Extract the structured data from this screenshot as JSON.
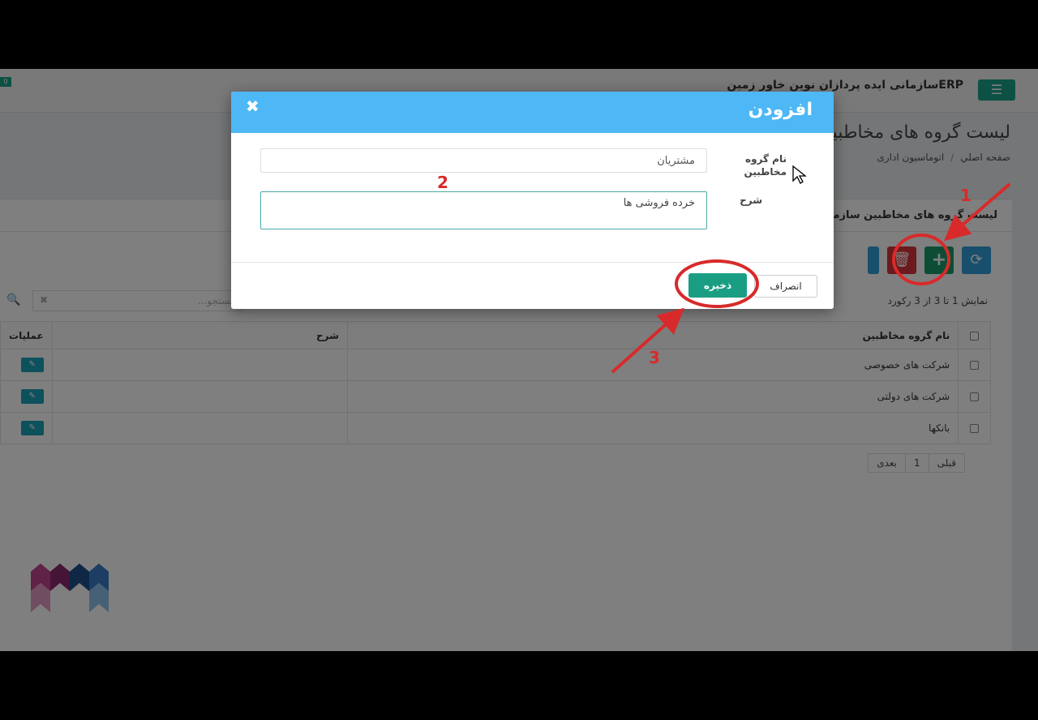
{
  "header": {
    "brand": "ERPسازمانی ایده پردازان نوین خاور زمین",
    "notification_count": "0"
  },
  "page": {
    "title": "لیست گروه های مخاطبین",
    "breadcrumb": [
      "صفحه اصلي",
      "اتوماسیون اداری"
    ]
  },
  "panel": {
    "title": "لیست گروه های مخاطبین سازمان",
    "record_info": "نمایش 1 تا 3 از 3 رکورد",
    "search_placeholder": "جستجو..."
  },
  "table": {
    "columns": [
      "نام گروه مخاطبین",
      "شرح",
      "عملیات"
    ],
    "rows": [
      {
        "name": "شرکت های خصوصی",
        "desc": ""
      },
      {
        "name": "شرکت های دولتی",
        "desc": ""
      },
      {
        "name": "بانکها",
        "desc": ""
      }
    ]
  },
  "pager": {
    "prev": "قبلی",
    "page": "1",
    "next": "بعدی"
  },
  "modal": {
    "title": "افزودن",
    "name_label": "نام گروه مخاطبین",
    "name_value": "مشتریان",
    "desc_label": "شرح",
    "desc_value": "خرده فروشی ها",
    "save_label": "ذخیره",
    "cancel_label": "انصراف"
  },
  "annotations": [
    "1",
    "2",
    "3"
  ],
  "colors": {
    "accent": "#1a9e83",
    "modal_header": "#4db8f5",
    "delete": "#d9353b",
    "refresh": "#2f9fd8",
    "annotation": "#d82a2a"
  }
}
